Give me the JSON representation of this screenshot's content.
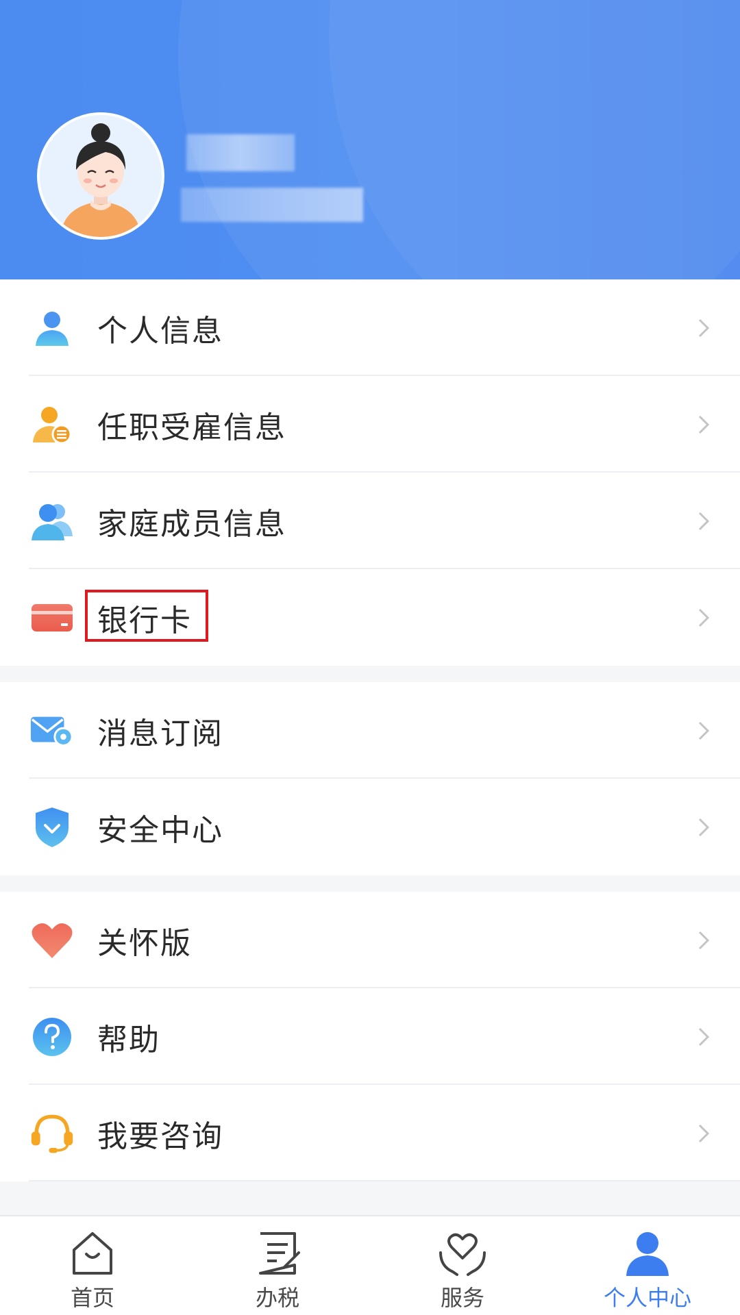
{
  "profile": {
    "name_masked": "",
    "id_masked": ""
  },
  "menu_groups": [
    {
      "items": [
        {
          "label": "个人信息",
          "icon": "person-icon",
          "highlighted": false
        },
        {
          "label": "任职受雇信息",
          "icon": "employment-icon",
          "highlighted": false
        },
        {
          "label": "家庭成员信息",
          "icon": "family-icon",
          "highlighted": false
        },
        {
          "label": "银行卡",
          "icon": "bank-card-icon",
          "highlighted": true
        }
      ]
    },
    {
      "items": [
        {
          "label": "消息订阅",
          "icon": "mail-settings-icon",
          "highlighted": false
        },
        {
          "label": "安全中心",
          "icon": "shield-icon",
          "highlighted": false
        }
      ]
    },
    {
      "items": [
        {
          "label": "关怀版",
          "icon": "heart-icon",
          "highlighted": false
        },
        {
          "label": "帮助",
          "icon": "help-icon",
          "highlighted": false
        },
        {
          "label": "我要咨询",
          "icon": "headset-icon",
          "highlighted": false
        }
      ]
    }
  ],
  "bottom_nav": {
    "tabs": [
      {
        "label": "首页",
        "icon": "home-icon",
        "active": false
      },
      {
        "label": "办税",
        "icon": "tax-form-icon",
        "active": false
      },
      {
        "label": "服务",
        "icon": "service-heart-icon",
        "active": false
      },
      {
        "label": "个人中心",
        "icon": "profile-icon",
        "active": true
      }
    ]
  },
  "colors": {
    "header_blue": "#4c8bf0",
    "active_tab": "#3c7ef0",
    "highlight_box": "#e0191e",
    "chevron": "#c4c4c4"
  }
}
